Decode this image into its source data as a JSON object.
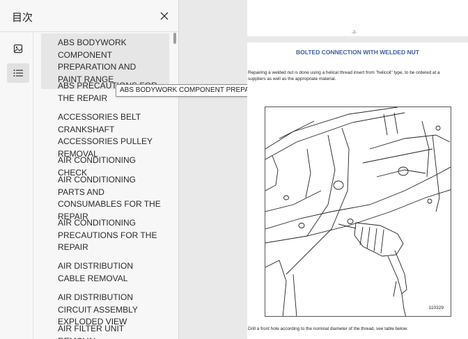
{
  "sidebar": {
    "title": "目次",
    "close_icon": "close-icon",
    "tabs": [
      {
        "name": "thumbnails",
        "icon": "image-icon"
      },
      {
        "name": "outline",
        "icon": "list-icon"
      }
    ],
    "items": [
      {
        "label": "ABS BODYWORK COMPONENT PREPARATION AND PAINT RANGE",
        "selected": true
      },
      {
        "label": "ABS PRECAUTIONS FOR THE REPAIR"
      },
      {
        "label": "ACCESSORIES BELT CRANKSHAFT ACCESSORIES PULLEY REMOVAL"
      },
      {
        "label": "AIR CONDITIONING CHECK"
      },
      {
        "label": "AIR CONDITIONING PARTS AND CONSUMABLES FOR THE REPAIR"
      },
      {
        "label": "AIR CONDITIONING PRECAUTIONS FOR THE REPAIR"
      },
      {
        "label": "AIR DISTRIBUTION CABLE REMOVAL"
      },
      {
        "label": "AIR DISTRIBUTION CIRCUIT ASSEMBLY EXPLODED VIEW"
      },
      {
        "label": "AIR FILTER UNIT REMOVAL"
      }
    ]
  },
  "tooltip": "ABS BODYWORK COMPONENT PREPARATION AND PAINT RANGE",
  "document": {
    "page_number": "-2-",
    "heading": "BOLTED CONNECTION WITH WELDED NUT",
    "body": "Repairing a welded nut is done using a helical thread insert from \"helicoil\" type, to be ordered at a suppliers as well as the appropriate material.",
    "figure_code": "110329",
    "caption": "Drill a front hole according to the nominal diameter of the thread, see table below."
  }
}
